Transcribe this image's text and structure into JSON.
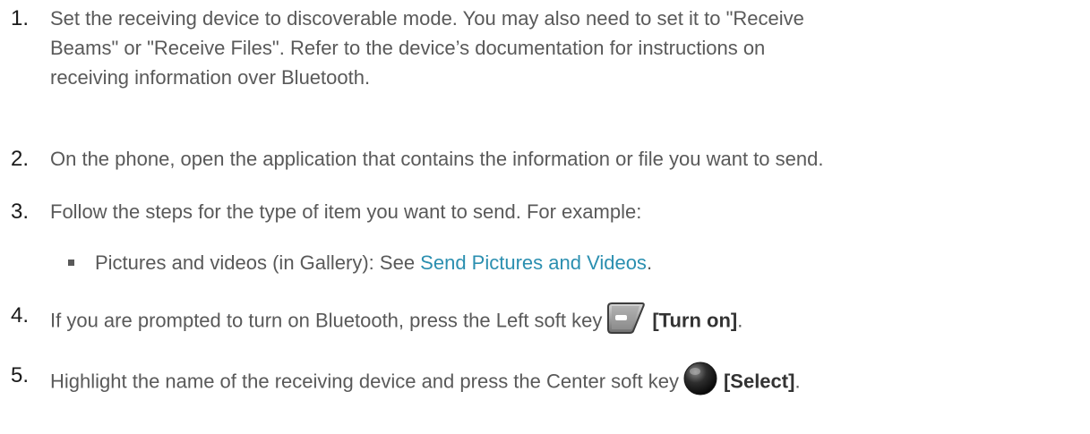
{
  "steps": [
    {
      "number": "1.",
      "text": "Set the receiving device to discoverable mode. You may also need to set it to \"Receive\nBeams\" or \"Receive Files\". Refer to the device’s documentation for instructions on\nreceiving information over Bluetooth."
    },
    {
      "number": "2.",
      "text": "On the phone, open the application that contains the information or file you want to send."
    },
    {
      "number": "3.",
      "text": "Follow the steps for the type of item you want to send. For example:",
      "sub_items": [
        {
          "prefix": "Pictures and videos (in Gallery): See ",
          "link": "Send Pictures and Videos",
          "suffix": "."
        }
      ]
    },
    {
      "number": "4.",
      "text_before": "If you are prompted to turn on Bluetooth, press the Left soft key",
      "key_icon": "left-soft-key-icon",
      "key_label": "[Turn on]",
      "text_after": "."
    },
    {
      "number": "5.",
      "text_before": "Highlight the name of the receiving device and press the Center soft key",
      "key_icon": "center-soft-key-icon",
      "key_label": "[Select]",
      "text_after": "."
    }
  ],
  "colors": {
    "body_text": "#595959",
    "number_text": "#1a1a1a",
    "link": "#2b8fb0"
  }
}
